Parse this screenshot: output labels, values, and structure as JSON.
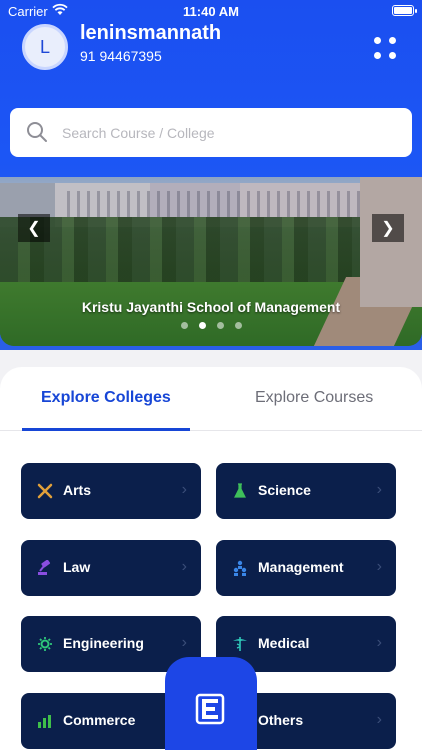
{
  "status_bar": {
    "carrier": "Carrier",
    "time": "11:40 AM"
  },
  "profile": {
    "initial": "L",
    "name": "leninsmannath",
    "phone": "91 94467395"
  },
  "search": {
    "placeholder": "Search Course / College"
  },
  "banner": {
    "caption": "Kristu Jayanthi School of Management",
    "slide_count": 4,
    "active_slide": 2
  },
  "tabs": [
    {
      "label": "Explore Colleges",
      "active": true
    },
    {
      "label": "Explore Courses",
      "active": false
    }
  ],
  "categories": [
    {
      "label": "Arts",
      "icon": "arts-icon",
      "color": "#e2a03a"
    },
    {
      "label": "Science",
      "icon": "flask-icon",
      "color": "#3fbf5a"
    },
    {
      "label": "Law",
      "icon": "gavel-icon",
      "color": "#8a4ee0"
    },
    {
      "label": "Management",
      "icon": "people-icon",
      "color": "#3a86e8"
    },
    {
      "label": "Engineering",
      "icon": "gear-icon",
      "color": "#2ec77a"
    },
    {
      "label": "Medical",
      "icon": "caduceus-icon",
      "color": "#2fc6b8"
    },
    {
      "label": "Commerce",
      "icon": "bar-chart-icon",
      "color": "#3fbf4a"
    },
    {
      "label": "Others",
      "icon": "others-icon",
      "color": "#3a86e8"
    }
  ],
  "colors": {
    "primary": "#1c4ff0",
    "card_bg": "#0b1f4b",
    "tab_active": "#1746d6"
  }
}
